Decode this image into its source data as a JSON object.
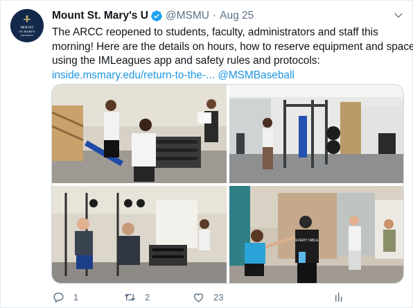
{
  "tweet": {
    "display_name": "Mount St. Mary's U",
    "handle": "@MSMU",
    "separator": "·",
    "date": "Aug 25",
    "avatar_text_line1": "MOUNT",
    "avatar_text_line2": "ST. MARY'S",
    "avatar_text_line3": "UNIVERSITY",
    "text_line1": "The ARCC reopened to students, faculty, administrators and staff this",
    "text_line2": "morning! Here are the details on hours, how to reserve equipment and space",
    "text_line3": "using the IMLeagues app and safety rules and protocols:",
    "link_url": "inside.msmary.edu/return-to-the-...",
    "link_mention": "@MSMBaseball",
    "photo4_shirt_text": "EVERY TABLE"
  },
  "actions": {
    "reply_count": "1",
    "retweet_count": "2",
    "like_count": "23"
  },
  "colors": {
    "link": "#1b95e0",
    "secondary": "#5b7083",
    "verified": "#1da1f2",
    "avatar_bg": "#13294b"
  },
  "icons": [
    "verified-badge-icon",
    "chevron-down-icon",
    "reply-icon",
    "retweet-icon",
    "like-icon",
    "share-icon"
  ]
}
